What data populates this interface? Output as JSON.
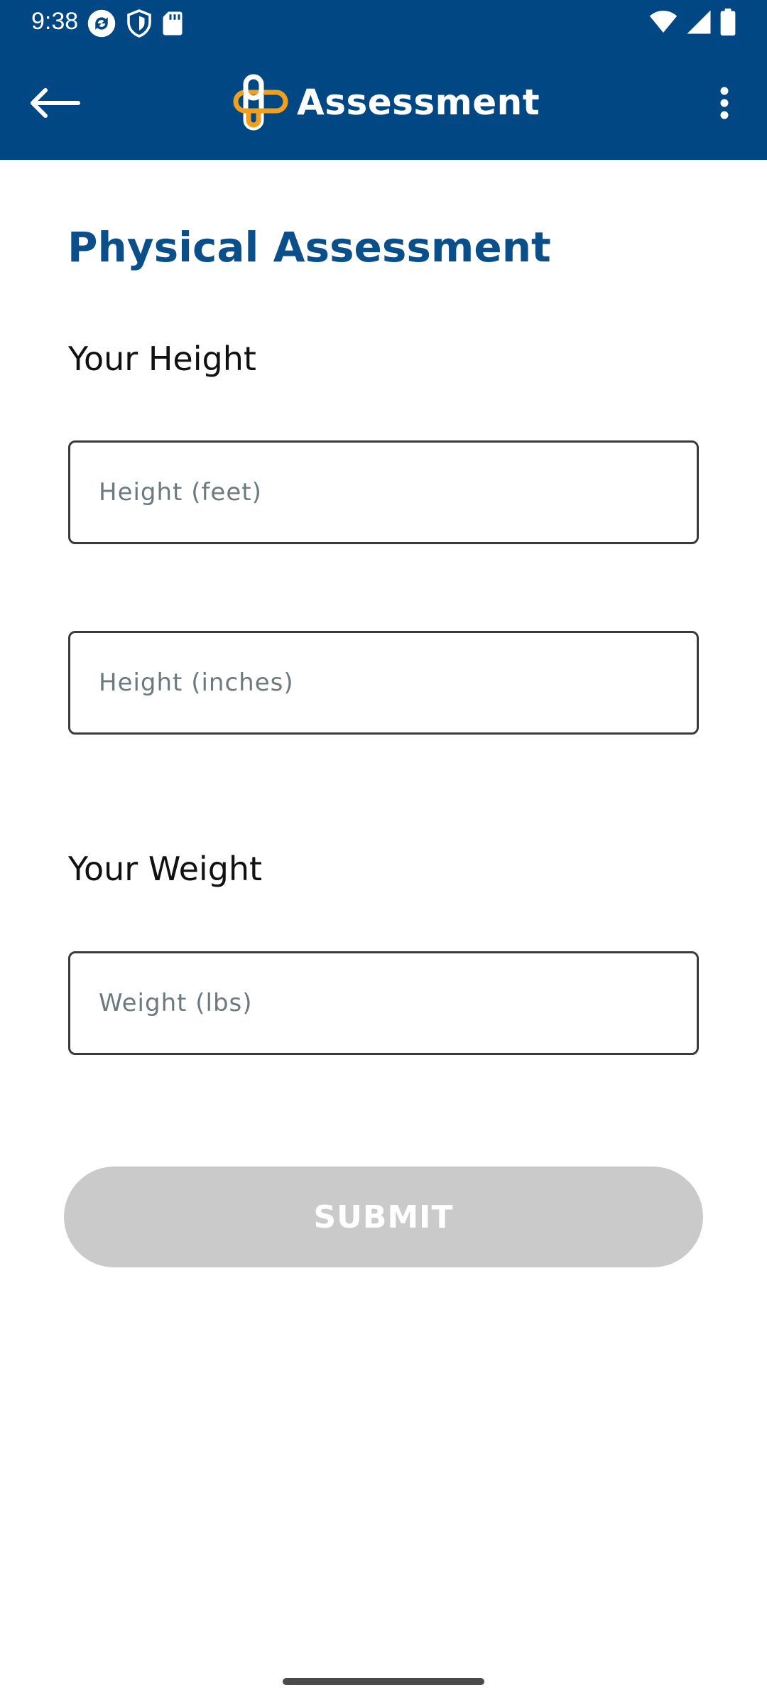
{
  "status_bar": {
    "time": "9:38",
    "icons_left": [
      "sync-icon",
      "shield-icon",
      "sd-card-icon"
    ],
    "icons_right": [
      "wifi-icon",
      "cell-signal-icon",
      "battery-icon"
    ]
  },
  "app_bar": {
    "title": "Assessment",
    "background_color": "#004784",
    "logo_colors": {
      "primary": "#ffffff",
      "accent": "#f0a01e"
    },
    "back_icon": "arrow-left-icon",
    "menu_icon": "more-vertical-icon"
  },
  "content": {
    "page_title": "Physical Assessment",
    "height_section_label": "Your Height",
    "height_feet_placeholder": "Height (feet)",
    "height_inches_placeholder": "Height (inches)",
    "weight_section_label": "Your Weight",
    "weight_placeholder": "Weight (lbs)",
    "submit_label": "SUBMIT",
    "submit_state": "disabled",
    "accent_color": "#0a4f8a"
  }
}
